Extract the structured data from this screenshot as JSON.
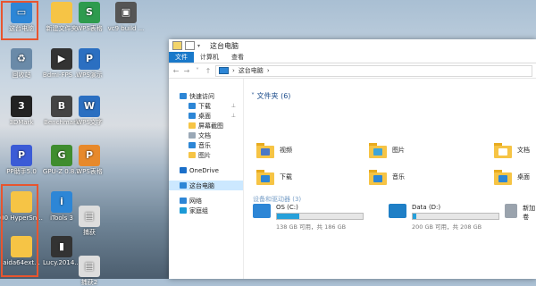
{
  "desktop": {
    "icons": [
      {
        "label": "这台电脑",
        "color": "#2d86d6",
        "glyph": "computer-icon",
        "char": "▭"
      },
      {
        "label": "新建文件夹",
        "color": "#f6c445",
        "glyph": "folder-icon",
        "char": ""
      },
      {
        "label": "WPS表格",
        "color": "#2e9b4e",
        "glyph": "wps-sheet-icon",
        "char": "S"
      },
      {
        "label": "vc9 build ...",
        "color": "#555",
        "glyph": "installer-icon",
        "char": "▣"
      },
      {
        "label": "回收站",
        "color": "#6a8aa8",
        "glyph": "recycle-bin-icon",
        "char": "♻"
      },
      {
        "label": "Bdmi-FPS ...",
        "color": "#333",
        "glyph": "app-icon",
        "char": "▶"
      },
      {
        "label": "WPS演示",
        "color": "#2b6fc1",
        "glyph": "wps-presentation-icon",
        "char": "P"
      },
      {
        "label": "3DMark",
        "color": "#222",
        "glyph": "3dmark-icon",
        "char": "3"
      },
      {
        "label": "Benchmark",
        "color": "#444",
        "glyph": "benchmark-icon",
        "char": "B"
      },
      {
        "label": "WPS文字",
        "color": "#2b6fc1",
        "glyph": "wps-writer-icon",
        "char": "W"
      },
      {
        "label": "PP助手5.0",
        "color": "#3b5bd6",
        "glyph": "pp-icon",
        "char": "P"
      },
      {
        "label": "GPU-Z 0.8.2",
        "color": "#3f8d2f",
        "glyph": "gpuz-icon",
        "char": "G"
      },
      {
        "label": "WPS表格",
        "color": "#e7892b",
        "glyph": "wps-icon",
        "char": "P"
      },
      {
        "label": "00 HyperSn...",
        "color": "#f6c445",
        "glyph": "folder-icon",
        "char": ""
      },
      {
        "label": "iTools 3",
        "color": "#2d86d6",
        "glyph": "itools-icon",
        "char": "i"
      },
      {
        "label": "捕获",
        "color": "#ddd",
        "glyph": "image-icon",
        "char": "▤"
      },
      {
        "label": "aida64ext...",
        "color": "#f6c445",
        "glyph": "folder-icon",
        "char": ""
      },
      {
        "label": "Lucy.2014...",
        "color": "#333",
        "glyph": "video-icon",
        "char": "▮"
      },
      {
        "label": "捕获2",
        "color": "#ddd",
        "glyph": "image-icon",
        "char": "▤"
      }
    ]
  },
  "window": {
    "title": "这台电脑",
    "ribbon_tabs": [
      "文件",
      "计算机",
      "查看"
    ],
    "address": "这台电脑",
    "nav": [
      {
        "label": "快速访问",
        "icon": "star-icon",
        "color": "#2d86d6",
        "level": 0,
        "pin": false,
        "sel": false,
        "gap": false
      },
      {
        "label": "下载",
        "icon": "download-icon",
        "color": "#2d86d6",
        "level": 1,
        "pin": true,
        "sel": false,
        "gap": false
      },
      {
        "label": "桌面",
        "icon": "desktop-icon",
        "color": "#2d86d6",
        "level": 1,
        "pin": true,
        "sel": false,
        "gap": false
      },
      {
        "label": "屏幕截图",
        "icon": "folder-icon",
        "color": "#f6c445",
        "level": 1,
        "pin": false,
        "sel": false,
        "gap": false
      },
      {
        "label": "文档",
        "icon": "document-icon",
        "color": "#9aa8b6",
        "level": 1,
        "pin": false,
        "sel": false,
        "gap": false
      },
      {
        "label": "音乐",
        "icon": "music-icon",
        "color": "#2d86d6",
        "level": 1,
        "pin": false,
        "sel": false,
        "gap": false
      },
      {
        "label": "图片",
        "icon": "picture-icon",
        "color": "#f6c445",
        "level": 1,
        "pin": false,
        "sel": false,
        "gap": false
      },
      {
        "label": "OneDrive",
        "icon": "onedrive-icon",
        "color": "#1b6fc9",
        "level": 0,
        "pin": false,
        "sel": false,
        "gap": true
      },
      {
        "label": "这台电脑",
        "icon": "computer-icon",
        "color": "#2d86d6",
        "level": 0,
        "pin": false,
        "sel": true,
        "gap": true
      },
      {
        "label": "网络",
        "icon": "network-icon",
        "color": "#2d86d6",
        "level": 0,
        "pin": false,
        "sel": false,
        "gap": true
      },
      {
        "label": "家庭组",
        "icon": "homegroup-icon",
        "color": "#1b9ad6",
        "level": 0,
        "pin": false,
        "sel": false,
        "gap": false
      }
    ],
    "folders_header": "文件夹 (6)",
    "folders": [
      {
        "label": "视频",
        "icon": "videos-icon",
        "glyph_color": "#4a78c7"
      },
      {
        "label": "图片",
        "icon": "pictures-icon",
        "glyph_color": "#3fa5d9"
      },
      {
        "label": "文档",
        "icon": "documents-icon",
        "glyph_color": "#ffffff"
      },
      {
        "label": "下载",
        "icon": "downloads-icon",
        "glyph_color": "#2d86d6"
      },
      {
        "label": "音乐",
        "icon": "music-icon",
        "glyph_color": "#2d86d6"
      },
      {
        "label": "桌面",
        "icon": "desktop-icon",
        "glyph_color": "#2d86d6"
      }
    ],
    "devices_header": "设备和驱动器 (3)",
    "drives": [
      {
        "name": "OS (C:)",
        "free": "138 GB 可用，共 186 GB",
        "used_fraction": 0.26,
        "icon": "windows-drive-icon",
        "color": "#2d86d6"
      },
      {
        "name": "Data (D:)",
        "free": "200 GB 可用，共 208 GB",
        "used_fraction": 0.04,
        "icon": "hdd-icon",
        "color": "#1f7fc6"
      },
      {
        "name": "新加卷",
        "free": "",
        "used_fraction": 0,
        "icon": "hdd-icon",
        "color": "#9aa3ad"
      }
    ]
  }
}
